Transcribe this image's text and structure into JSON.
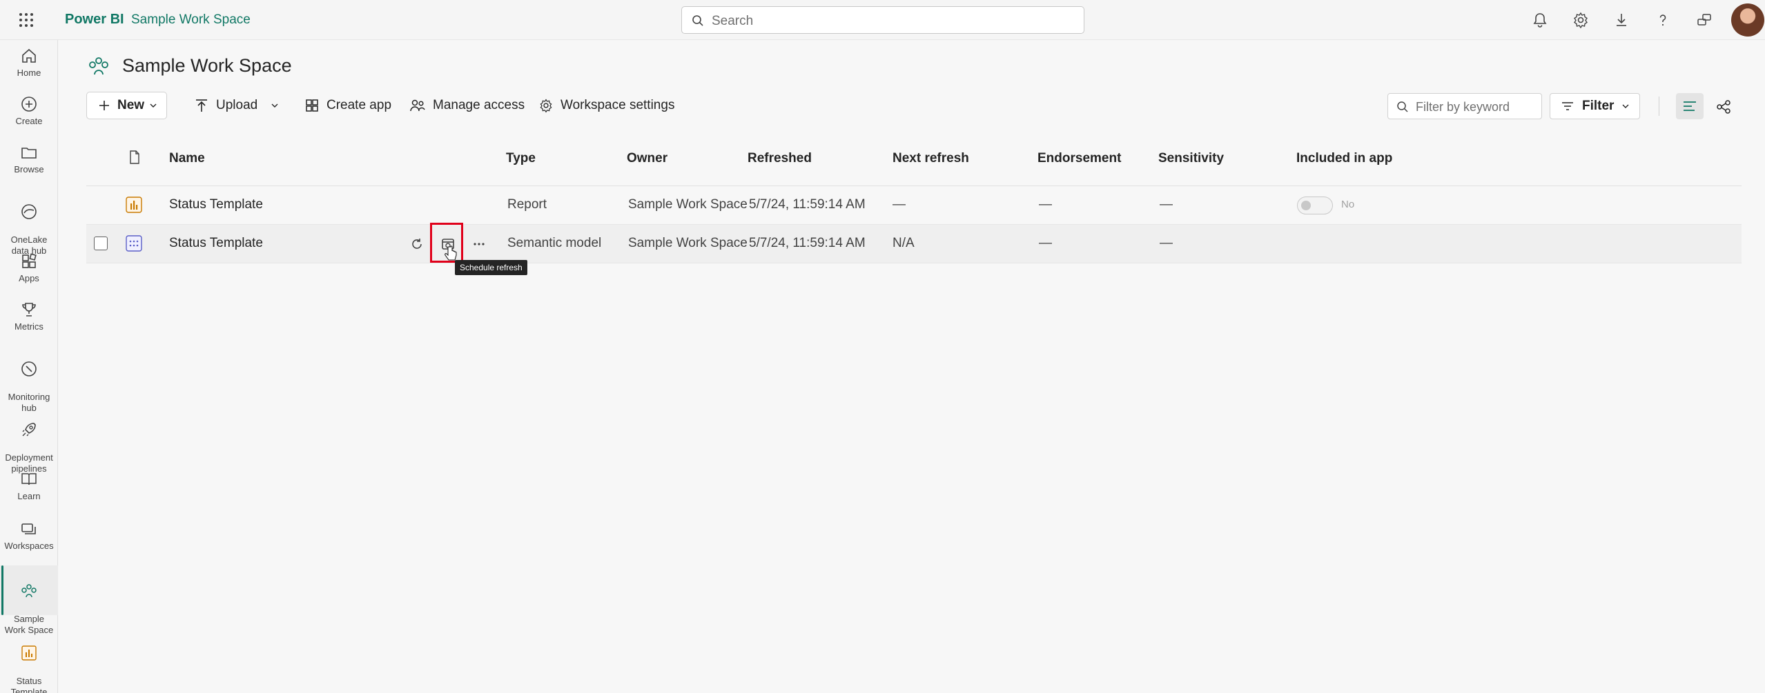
{
  "topbar": {
    "brand": "Power BI",
    "workspace_crumb": "Sample Work Space",
    "search_placeholder": "Search"
  },
  "icons": [
    "waffle-icon",
    "bell-icon",
    "gear-icon",
    "download-icon",
    "help-icon",
    "share-icon"
  ],
  "leftnav": {
    "items": [
      {
        "label": "Home",
        "icon": "home-icon"
      },
      {
        "label": "Create",
        "icon": "plus-circle-icon"
      },
      {
        "label": "Browse",
        "icon": "folder-icon"
      },
      {
        "label": "OneLake\ndata hub",
        "icon": "onelake-icon"
      },
      {
        "label": "Apps",
        "icon": "apps-icon"
      },
      {
        "label": "Metrics",
        "icon": "trophy-icon"
      },
      {
        "label": "Monitoring\nhub",
        "icon": "monitor-icon"
      },
      {
        "label": "Deployment\npipelines",
        "icon": "rocket-icon"
      },
      {
        "label": "Learn",
        "icon": "book-icon"
      },
      {
        "label": "Workspaces",
        "icon": "workspaces-icon"
      },
      {
        "label": "Sample\nWork Space",
        "icon": "people-icon",
        "active": true
      },
      {
        "label": "Status\nTemplate",
        "icon": "report-icon"
      }
    ]
  },
  "workspace": {
    "title": "Sample Work Space"
  },
  "toolbar": {
    "new": "New",
    "upload": "Upload",
    "create_app": "Create app",
    "manage_access": "Manage access",
    "workspace_settings": "Workspace settings",
    "filter_placeholder": "Filter by keyword",
    "filter": "Filter"
  },
  "table": {
    "columns": [
      "Name",
      "Type",
      "Owner",
      "Refreshed",
      "Next refresh",
      "Endorsement",
      "Sensitivity",
      "Included in app"
    ],
    "rows": [
      {
        "name": "Status Template",
        "type": "Report",
        "owner": "Sample Work Space",
        "refreshed": "5/7/24, 11:59:14 AM",
        "next_refresh": "—",
        "endorsement": "—",
        "sensitivity": "—",
        "included": "No"
      },
      {
        "name": "Status Template",
        "type": "Semantic model",
        "owner": "Sample Work Space",
        "refreshed": "5/7/24, 11:59:14 AM",
        "next_refresh": "N/A",
        "endorsement": "—",
        "sensitivity": "—",
        "included": ""
      }
    ]
  },
  "tooltip": "Schedule refresh",
  "colors": {
    "accent": "#117865",
    "highlight": "#e0001a",
    "report_icon": "#c97a00",
    "model_icon": "#5b5fc7"
  }
}
